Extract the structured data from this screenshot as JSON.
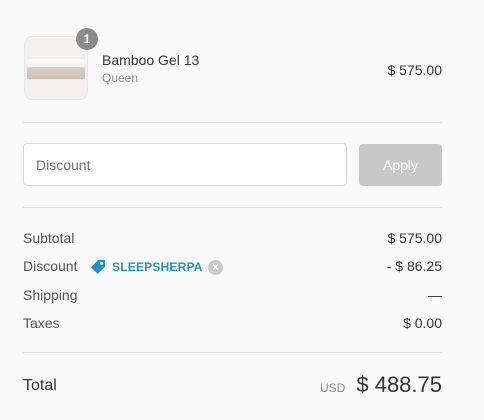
{
  "line_item": {
    "quantity_badge": "1",
    "name": "Bamboo Gel 13",
    "variant": "Queen",
    "price": "$ 575.00"
  },
  "discount_form": {
    "placeholder": "Discount",
    "value": "",
    "apply_label": "Apply"
  },
  "summary": {
    "subtotal_label": "Subtotal",
    "subtotal_value": "$ 575.00",
    "discount_label": "Discount",
    "discount_code": "SLEEPSHERPA",
    "discount_value": "- $ 86.25",
    "shipping_label": "Shipping",
    "shipping_value": "—",
    "taxes_label": "Taxes",
    "taxes_value": "$ 0.00"
  },
  "total": {
    "label": "Total",
    "currency": "USD",
    "value": "$ 488.75"
  },
  "colors": {
    "accent": "#2a8ec1",
    "button_disabled": "#c8c8c8",
    "background": "#fafafa"
  }
}
